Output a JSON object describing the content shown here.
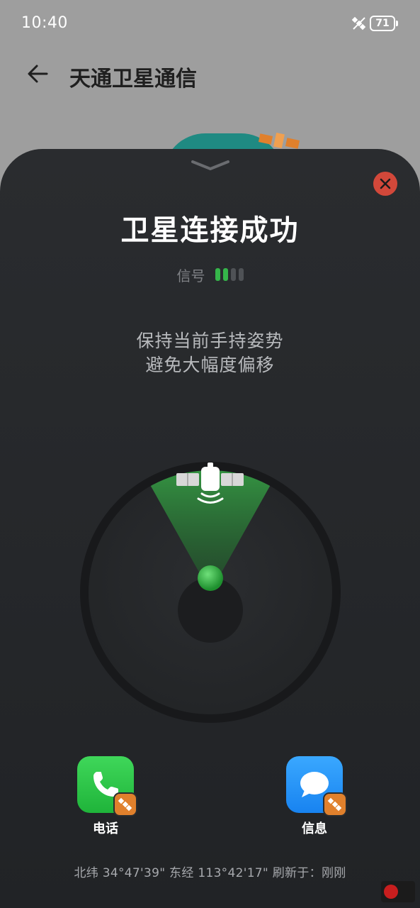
{
  "status_bar": {
    "time": "10:40",
    "battery": "71",
    "satellite_icon": "satellite-icon"
  },
  "header": {
    "title": "天通卫星通信",
    "back_icon": "arrow-left-icon"
  },
  "sheet": {
    "title": "卫星连接成功",
    "signal_label": "信号",
    "signal_level": 2,
    "signal_max": 4,
    "hint_lines": [
      "保持当前手持姿势",
      "避免大幅度偏移"
    ]
  },
  "apps": {
    "phone": {
      "label": "电话",
      "icon": "phone-icon"
    },
    "messages": {
      "label": "信息",
      "icon": "message-bubble-icon"
    }
  },
  "location": {
    "text": "北纬 34°47'39\" 东经 113°42'17\" 刷新于：刚刚"
  },
  "colors": {
    "accent_green": "#35b54a",
    "close_red": "#d2483a",
    "sheet_bg": "#2a2c2f"
  }
}
